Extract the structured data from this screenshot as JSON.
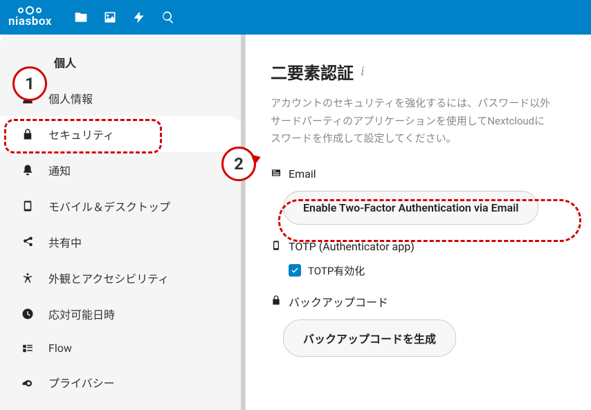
{
  "brand": {
    "name": "niasbox"
  },
  "sidebar": {
    "section": "個人",
    "items": [
      {
        "label": "個人情報"
      },
      {
        "label": "セキュリティ"
      },
      {
        "label": "通知"
      },
      {
        "label": "モバイル＆デスクトップ"
      },
      {
        "label": "共有中"
      },
      {
        "label": "外観とアクセシビリティ"
      },
      {
        "label": "応対可能日時"
      },
      {
        "label": "Flow"
      },
      {
        "label": "プライバシー"
      }
    ]
  },
  "main": {
    "heading": "二要素認証",
    "desc_line1": "アカウントのセキュリティを強化するには、パスワード以外",
    "desc_line2": "サードパーティのアプリケーションを使用してNextcloudに",
    "desc_line3": "スワードを作成して設定してください。",
    "email": {
      "title": "Email",
      "button": "Enable Two-Factor Authentication via Email"
    },
    "totp": {
      "title": "TOTP (Authenticator app)",
      "checkbox": "TOTP有効化"
    },
    "backup": {
      "title": "バックアップコード",
      "button": "バックアップコードを生成"
    }
  },
  "annotations": {
    "a1": "1",
    "a2": "2"
  }
}
